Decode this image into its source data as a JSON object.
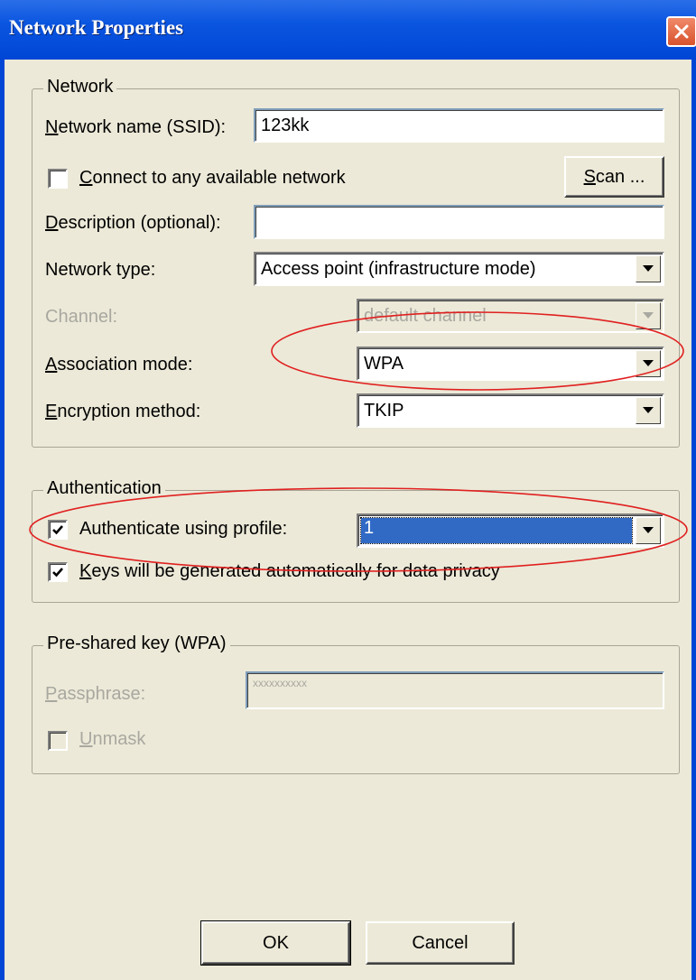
{
  "window": {
    "title": "Network Properties"
  },
  "network_group": {
    "title": "Network",
    "ssid": {
      "label": "Network name (SSID):",
      "value": "123kk"
    },
    "connect_any": {
      "label": "Connect to any available network",
      "checked": false
    },
    "scan_button": "Scan ...",
    "description": {
      "label": "Description (optional):",
      "value": ""
    },
    "network_type": {
      "label": "Network type:",
      "value": "Access point (infrastructure mode)"
    },
    "channel": {
      "label": "Channel:",
      "value": "default channel",
      "disabled": true
    },
    "association_mode": {
      "label": "Association mode:",
      "value": "WPA"
    },
    "encryption_method": {
      "label": "Encryption method:",
      "value": "TKIP"
    }
  },
  "authentication_group": {
    "title": "Authentication",
    "authenticate_profile": {
      "label": "Authenticate using profile:",
      "checked": true,
      "value": "1"
    },
    "auto_keys": {
      "label": "Keys will be generated automatically for data privacy",
      "checked": true
    }
  },
  "psk_group": {
    "title": "Pre-shared key (WPA)",
    "passphrase": {
      "label": "Passphrase:",
      "value": "xxxxxxxxxx",
      "disabled": true
    },
    "unmask": {
      "label": "Unmask",
      "checked": false,
      "disabled": true
    }
  },
  "buttons": {
    "ok": "OK",
    "cancel": "Cancel"
  },
  "colors": {
    "titlebar": "#0046d5",
    "dialog_bg": "#ece9d8",
    "selection": "#316ac5",
    "annotation": "#e02020"
  }
}
